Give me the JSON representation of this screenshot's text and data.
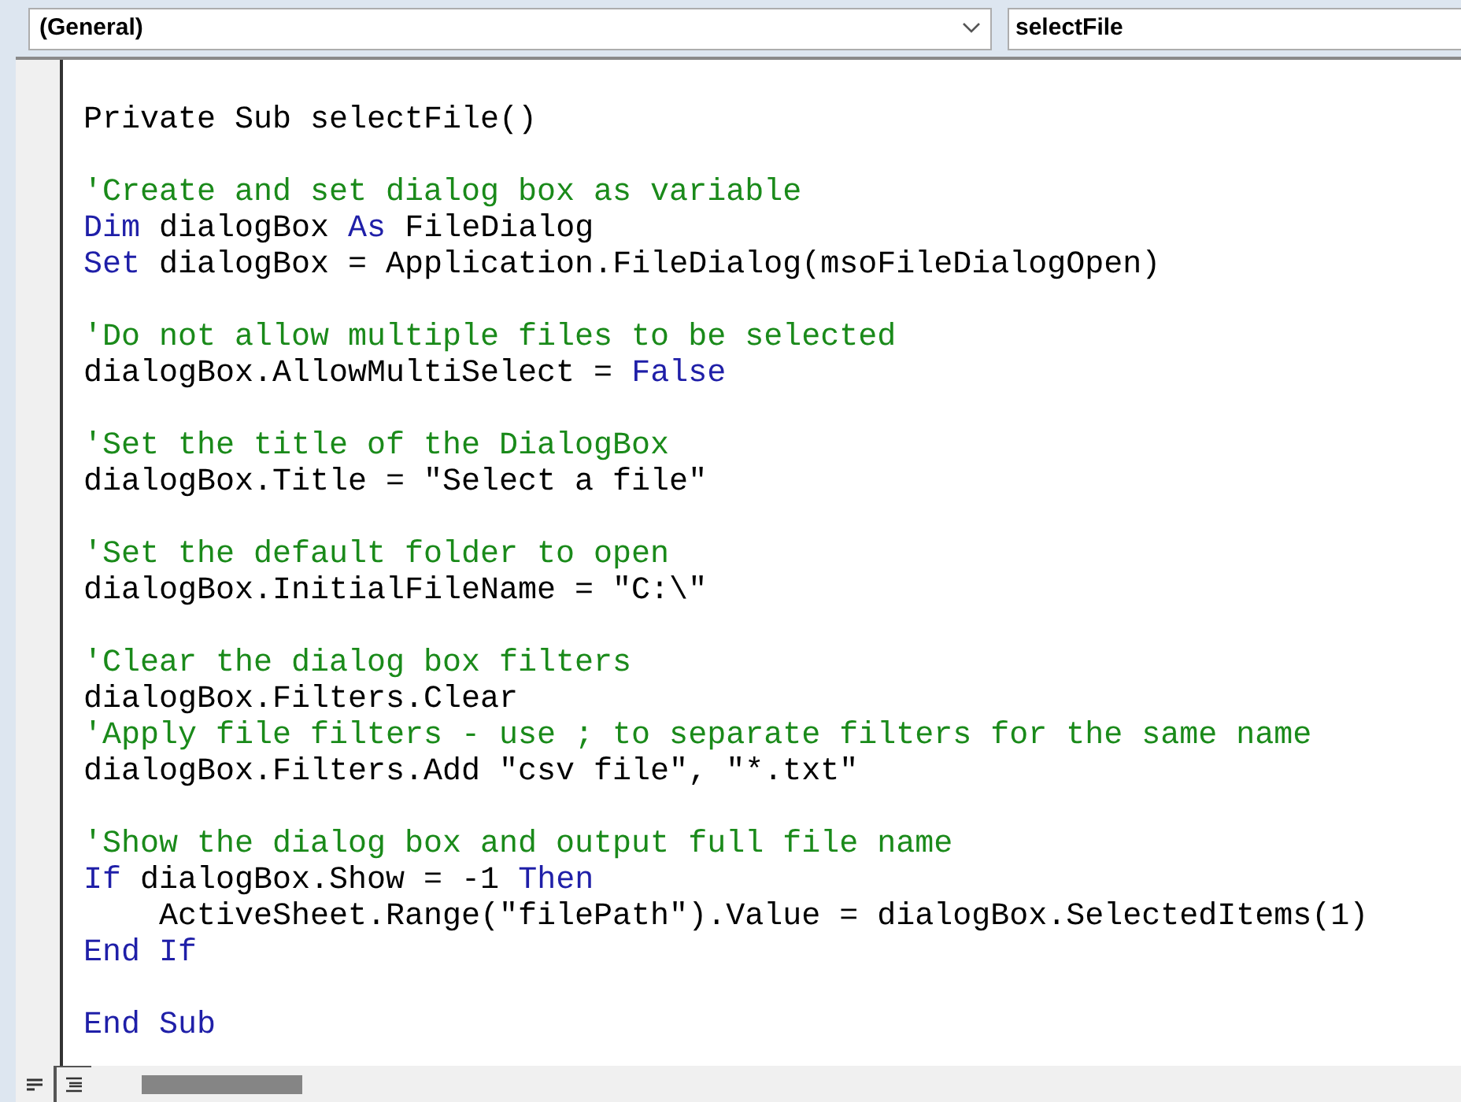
{
  "toolbar": {
    "object_dropdown": {
      "value": "(General)"
    },
    "procedure_dropdown": {
      "value": "selectFile"
    }
  },
  "code": [
    {
      "kind": "code",
      "tokens": [
        {
          "kind": "plain",
          "text": "Private Sub"
        },
        {
          "kind": "plain",
          "text": " selectFile()"
        }
      ]
    },
    {
      "kind": "blank"
    },
    {
      "kind": "code",
      "tokens": [
        {
          "kind": "comment",
          "text": "'Create and set dialog box as variable"
        }
      ]
    },
    {
      "kind": "code",
      "tokens": [
        {
          "kind": "keyword",
          "text": "Dim"
        },
        {
          "kind": "plain",
          "text": " dialogBox "
        },
        {
          "kind": "keyword",
          "text": "As"
        },
        {
          "kind": "plain",
          "text": " FileDialog"
        }
      ]
    },
    {
      "kind": "code",
      "tokens": [
        {
          "kind": "keyword",
          "text": "Set"
        },
        {
          "kind": "plain",
          "text": " dialogBox = Application.FileDialog(msoFileDialogOpen)"
        }
      ]
    },
    {
      "kind": "blank"
    },
    {
      "kind": "code",
      "tokens": [
        {
          "kind": "comment",
          "text": "'Do not allow multiple files to be selected"
        }
      ]
    },
    {
      "kind": "code",
      "tokens": [
        {
          "kind": "plain",
          "text": "dialogBox.AllowMultiSelect = "
        },
        {
          "kind": "keyword",
          "text": "False"
        }
      ]
    },
    {
      "kind": "blank"
    },
    {
      "kind": "code",
      "tokens": [
        {
          "kind": "comment",
          "text": "'Set the title of the DialogBox"
        }
      ]
    },
    {
      "kind": "code",
      "tokens": [
        {
          "kind": "plain",
          "text": "dialogBox.Title = \"Select a file\""
        }
      ]
    },
    {
      "kind": "blank"
    },
    {
      "kind": "code",
      "tokens": [
        {
          "kind": "comment",
          "text": "'Set the default folder to open"
        }
      ]
    },
    {
      "kind": "code",
      "tokens": [
        {
          "kind": "plain",
          "text": "dialogBox.InitialFileName = \"C:\\\""
        }
      ]
    },
    {
      "kind": "blank"
    },
    {
      "kind": "code",
      "tokens": [
        {
          "kind": "comment",
          "text": "'Clear the dialog box filters"
        }
      ]
    },
    {
      "kind": "code",
      "tokens": [
        {
          "kind": "plain",
          "text": "dialogBox.Filters.Clear"
        }
      ]
    },
    {
      "kind": "code",
      "tokens": [
        {
          "kind": "comment",
          "text": "'Apply file filters - use ; to separate filters for the same name"
        }
      ]
    },
    {
      "kind": "code",
      "tokens": [
        {
          "kind": "plain",
          "text": "dialogBox.Filters.Add \"csv file\", \"*.txt\""
        }
      ]
    },
    {
      "kind": "blank"
    },
    {
      "kind": "code",
      "tokens": [
        {
          "kind": "comment",
          "text": "'Show the dialog box and output full file name"
        }
      ]
    },
    {
      "kind": "code",
      "tokens": [
        {
          "kind": "keyword",
          "text": "If"
        },
        {
          "kind": "plain",
          "text": " dialogBox.Show = -1 "
        },
        {
          "kind": "keyword",
          "text": "Then"
        }
      ]
    },
    {
      "kind": "code",
      "tokens": [
        {
          "kind": "plain",
          "text": "    ActiveSheet.Range(\"filePath\").Value = dialogBox.SelectedItems(1)"
        }
      ]
    },
    {
      "kind": "code",
      "tokens": [
        {
          "kind": "keyword",
          "text": "End If"
        }
      ]
    },
    {
      "kind": "blank"
    },
    {
      "kind": "code",
      "tokens": [
        {
          "kind": "keyword",
          "text": "End Sub"
        }
      ]
    }
  ]
}
